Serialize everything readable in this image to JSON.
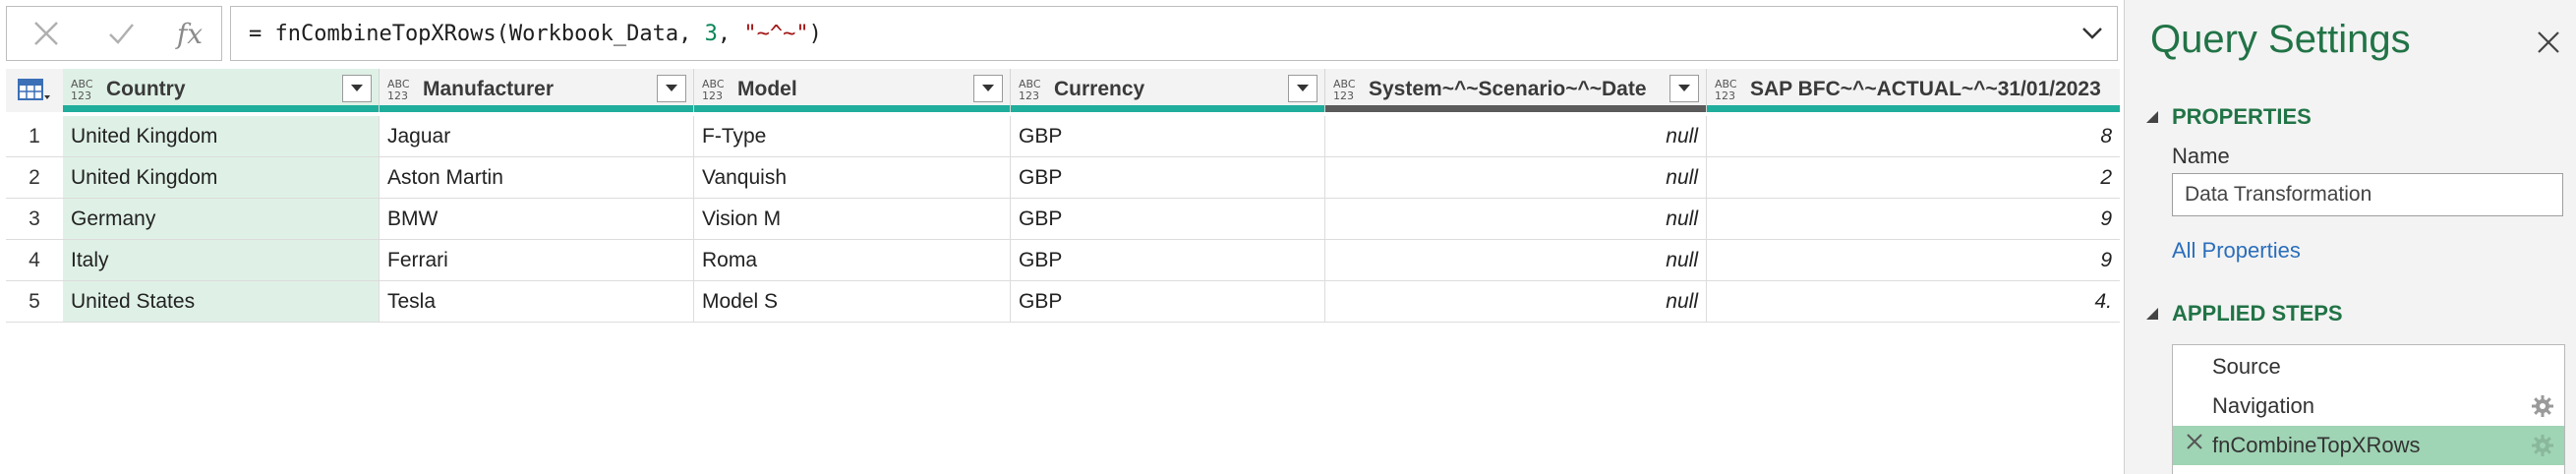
{
  "formula_bar": {
    "cancel_icon": "x-icon",
    "commit_icon": "check-icon",
    "fx_label": "fx",
    "prefix": "= fnCombineTopXRows(Workbook_Data, ",
    "arg_number": "3",
    "sep": ", ",
    "arg_string": "\"~^~\"",
    "suffix": ")"
  },
  "columns": [
    {
      "type": "ABC 123",
      "name": "Country",
      "selected": true
    },
    {
      "type": "ABC 123",
      "name": "Manufacturer",
      "selected": false
    },
    {
      "type": "ABC 123",
      "name": "Model",
      "selected": false
    },
    {
      "type": "ABC 123",
      "name": "Currency",
      "selected": false
    },
    {
      "type": "ABC 123",
      "name": "System~^~Scenario~^~Date",
      "selected": false
    },
    {
      "type": "ABC 123",
      "name": "SAP BFC~^~ACTUAL~^~31/01/2023",
      "selected": false
    }
  ],
  "rows": [
    {
      "n": "1",
      "cells": [
        "United Kingdom",
        "Jaguar",
        "F-Type",
        "GBP",
        "null",
        "8"
      ]
    },
    {
      "n": "2",
      "cells": [
        "United Kingdom",
        "Aston Martin",
        "Vanquish",
        "GBP",
        "null",
        "2"
      ]
    },
    {
      "n": "3",
      "cells": [
        "Germany",
        "BMW",
        "Vision M",
        "GBP",
        "null",
        "9"
      ]
    },
    {
      "n": "4",
      "cells": [
        "Italy",
        "Ferrari",
        "Roma",
        "GBP",
        "null",
        "9"
      ]
    },
    {
      "n": "5",
      "cells": [
        "United States",
        "Tesla",
        "Model S",
        "GBP",
        "null",
        "4."
      ]
    }
  ],
  "query_settings": {
    "title": "Query Settings",
    "properties_heading": "PROPERTIES",
    "name_label": "Name",
    "name_value": "Data Transformation",
    "all_properties_link": "All Properties",
    "applied_steps_heading": "APPLIED STEPS",
    "steps": [
      {
        "label": "Source",
        "has_gear": false,
        "active": false
      },
      {
        "label": "Navigation",
        "has_gear": true,
        "active": false
      },
      {
        "label": "fnCombineTopXRows",
        "has_gear": true,
        "active": true
      }
    ]
  },
  "colors": {
    "accent_green": "#217346",
    "quality_bar": "#1fae9c",
    "selected_column": "#dff1e6",
    "active_step": "#9fd4b4",
    "link_blue": "#2a6ebb"
  }
}
